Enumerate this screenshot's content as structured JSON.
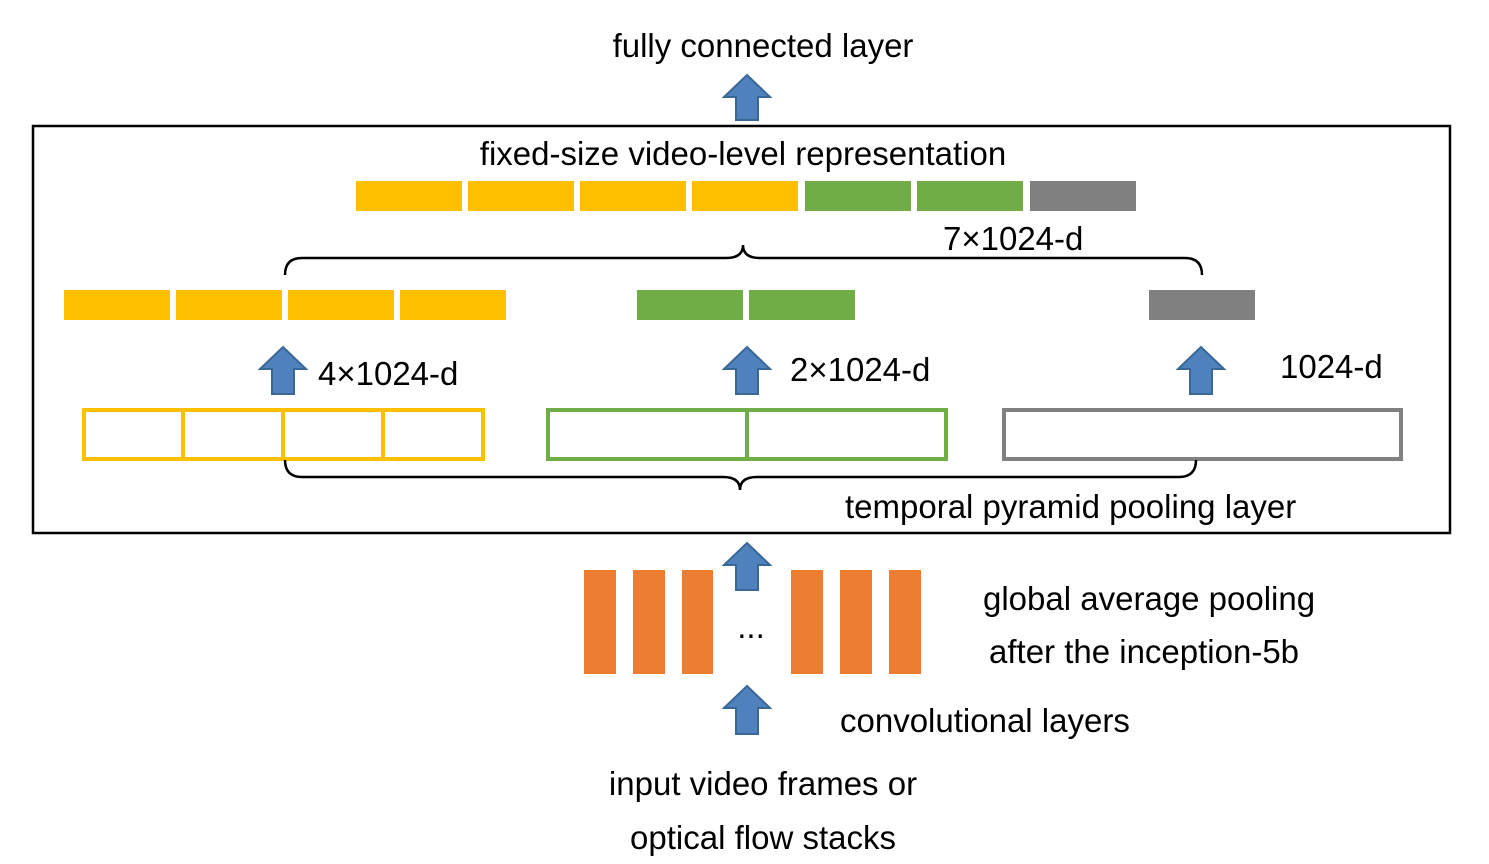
{
  "labels": {
    "fully_connected": "fully connected layer",
    "fixed_size": "fixed-size video-level representation",
    "seven": "7×1024-d",
    "four": "4×1024-d",
    "two": "2×1024-d",
    "one": "1024-d",
    "tpp": "temporal pyramid pooling layer",
    "gap1": "global average pooling",
    "gap2": "after the inception-5b",
    "dots": "...",
    "conv": "convolutional layers",
    "input1": "input video frames or",
    "input2": "optical flow stacks"
  },
  "colors": {
    "yellow": "#FFC000",
    "green": "#70AD47",
    "gray": "#808080",
    "orange": "#ED7D31",
    "arrow": "#4F81BD"
  },
  "icons": [
    "arrow-up-icon",
    "curly-brace-icon"
  ]
}
